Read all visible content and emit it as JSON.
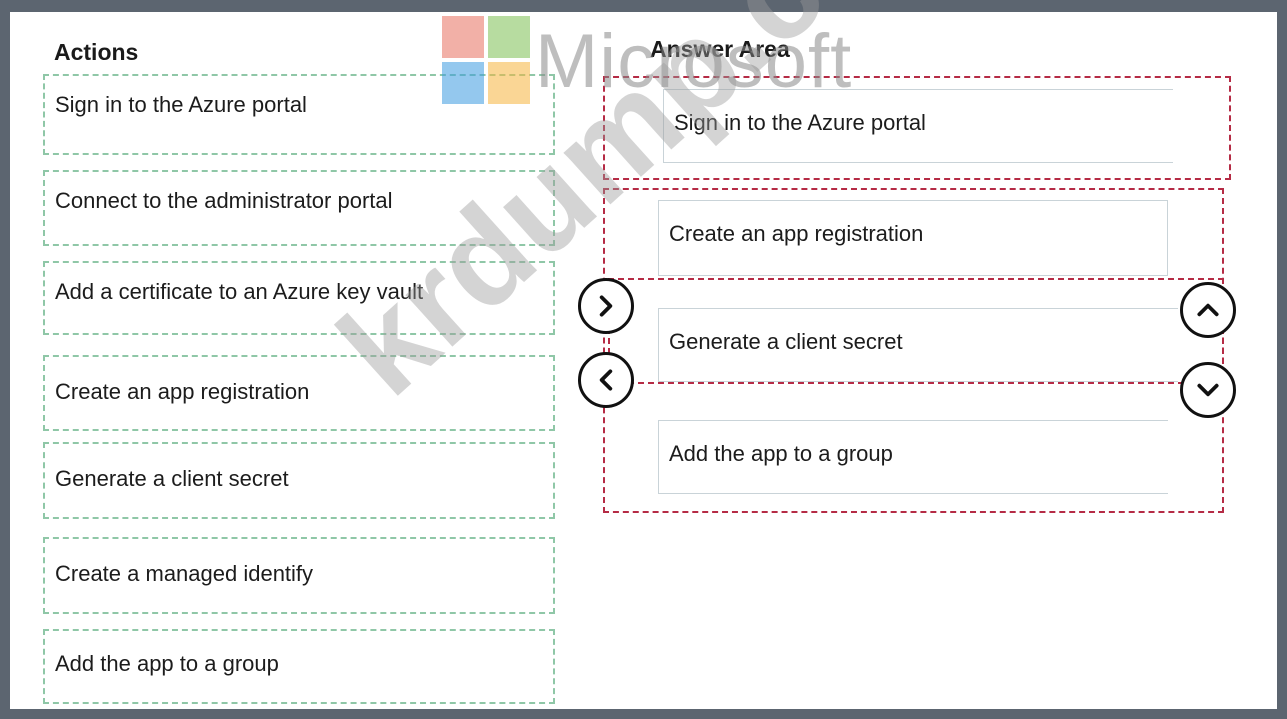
{
  "actions": {
    "title": "Actions",
    "items": [
      "Sign in to the Azure portal",
      "Connect to the administrator portal",
      "Add a certificate to an Azure key vault",
      "Create an app registration",
      "Generate a client secret",
      "Create a managed identify",
      "Add the app to a group"
    ]
  },
  "answer_area": {
    "title": "Answer Area",
    "items": [
      "Sign in to the Azure portal",
      "Create an app registration",
      "Generate a client secret",
      "Add the app to a group"
    ]
  },
  "watermark": {
    "logo_text": "Microsoft",
    "site_text": "krdump.com"
  },
  "colors": {
    "action_border": "#8fc7a7",
    "answer_border": "#b52b45",
    "logo": [
      "#e8705e",
      "#7cbf52",
      "#3c9ae0",
      "#f5b43e"
    ]
  },
  "icons": {
    "move_right": "chevron-right-icon",
    "move_left": "chevron-left-icon",
    "move_up": "chevron-up-icon",
    "move_down": "chevron-down-icon"
  }
}
